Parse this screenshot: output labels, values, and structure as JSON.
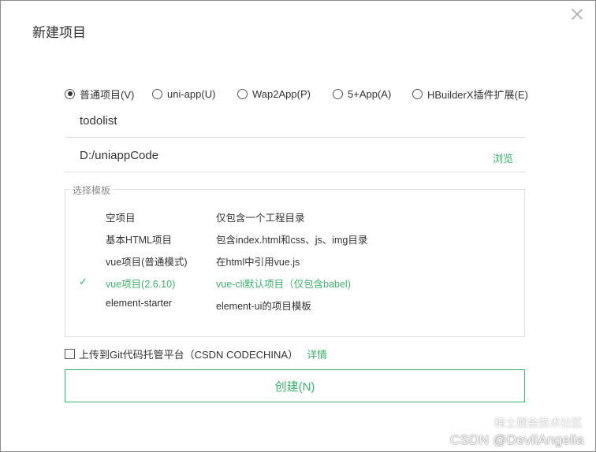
{
  "dialog": {
    "title": "新建项目"
  },
  "project_types": [
    {
      "label": "普通项目(V)",
      "checked": true
    },
    {
      "label": "uni-app(U)",
      "checked": false
    },
    {
      "label": "Wap2App(P)",
      "checked": false
    },
    {
      "label": "5+App(A)",
      "checked": false
    },
    {
      "label": "HBuilderX插件扩展(E)",
      "checked": false
    }
  ],
  "fields": {
    "project_name": "todolist",
    "location": "D:/uniappCode",
    "browse_label": "浏览"
  },
  "templates": {
    "legend": "选择模板",
    "items": [
      {
        "name": "空项目",
        "desc": "仅包含一个工程目录",
        "selected": false
      },
      {
        "name": "基本HTML项目",
        "desc": "包含index.html和css、js、img目录",
        "selected": false
      },
      {
        "name": "vue项目(普通模式)",
        "desc": "在html中引用vue.js",
        "selected": false
      },
      {
        "name": "vue项目(2.6.10)",
        "desc": "vue-cli默认项目（仅包含babel)",
        "selected": true,
        "check": "✓"
      },
      {
        "name": "element-starter",
        "desc": "element-ui的项目模板",
        "selected": false
      }
    ]
  },
  "git": {
    "label": "上传到Git代码托管平台（CSDN CODECHINA）",
    "details_label": "详情",
    "checked": false
  },
  "create_label": "创建(N)",
  "watermark": {
    "top_text": "稀土掘金技术社区",
    "bottom_text": "CSDN @DevilAngelia"
  },
  "colors": {
    "accent": "#3bb46d",
    "border": "#dddddd",
    "text": "#333333"
  }
}
